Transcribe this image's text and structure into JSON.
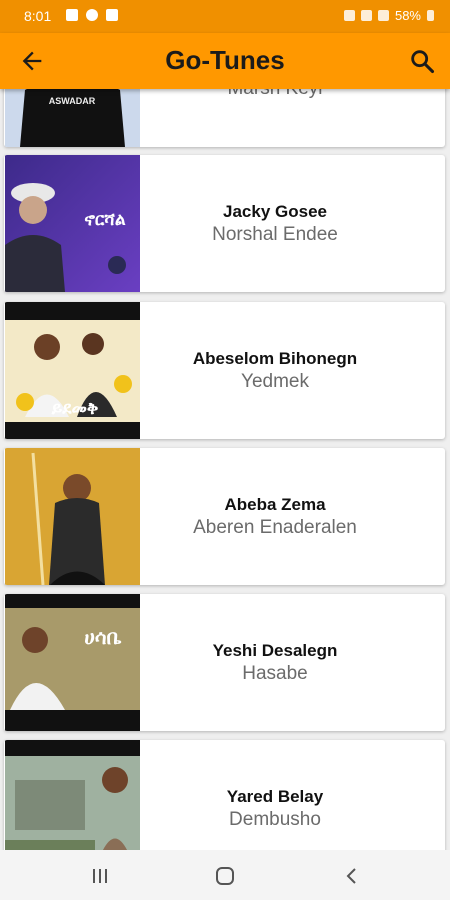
{
  "status": {
    "time": "8:01",
    "battery": "58%"
  },
  "appbar": {
    "title": "Go-Tunes",
    "back_icon": "arrow-left-icon",
    "search_icon": "search-icon"
  },
  "songs": [
    {
      "artist": "",
      "title": "Marsh Keyi"
    },
    {
      "artist": "Jacky Gosee",
      "title": "Norshal Endee"
    },
    {
      "artist": "Abeselom Bihonegn",
      "title": "Yedmek"
    },
    {
      "artist": "Abeba Zema",
      "title": "Aberen Enaderalen"
    },
    {
      "artist": "Yeshi Desalegn",
      "title": "Hasabe"
    },
    {
      "artist": "Yared Belay",
      "title": "Dembusho"
    }
  ],
  "thumb_texts": [
    "ASWADAR",
    "ኖርሻል",
    "ይደመቅ",
    "ሀሳቤ"
  ],
  "navbar": {
    "recents_icon": "recent-apps-icon",
    "home_icon": "home-icon",
    "back_icon": "nav-back-icon"
  },
  "colors": {
    "accent": "#ff9800",
    "statusbar": "#f09000"
  }
}
